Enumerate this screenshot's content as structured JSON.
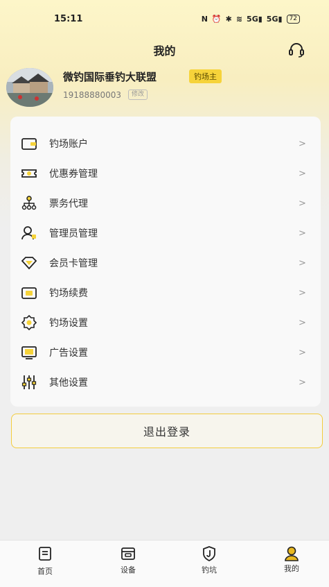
{
  "status_bar": {
    "time": "15:11",
    "signal1": "5G",
    "signal2": "5G",
    "battery": "72"
  },
  "header": {
    "title": "我的"
  },
  "profile": {
    "name": "微钓国际垂钓大联盟",
    "role": "钓场主",
    "phone": "19188880003",
    "edit_label": "修改"
  },
  "menu": {
    "items": [
      {
        "label": "钓场账户",
        "icon": "wallet-icon"
      },
      {
        "label": "优惠券管理",
        "icon": "coupon-icon"
      },
      {
        "label": "票务代理",
        "icon": "org-chart-icon"
      },
      {
        "label": "管理员管理",
        "icon": "admin-icon"
      },
      {
        "label": "会员卡管理",
        "icon": "diamond-icon"
      },
      {
        "label": "钓场续费",
        "icon": "renew-icon"
      },
      {
        "label": "钓场设置",
        "icon": "settings-icon"
      },
      {
        "label": "广告设置",
        "icon": "ad-icon"
      },
      {
        "label": "其他设置",
        "icon": "sliders-icon"
      }
    ],
    "chevron": ">"
  },
  "logout": {
    "label": "退出登录"
  },
  "tabs": [
    {
      "label": "首页",
      "icon": "home-icon"
    },
    {
      "label": "设备",
      "icon": "device-icon"
    },
    {
      "label": "钓坑",
      "icon": "spot-icon"
    },
    {
      "label": "我的",
      "icon": "profile-icon"
    }
  ],
  "colors": {
    "accent": "#f6d33a",
    "active_icon": "#e8b820"
  }
}
